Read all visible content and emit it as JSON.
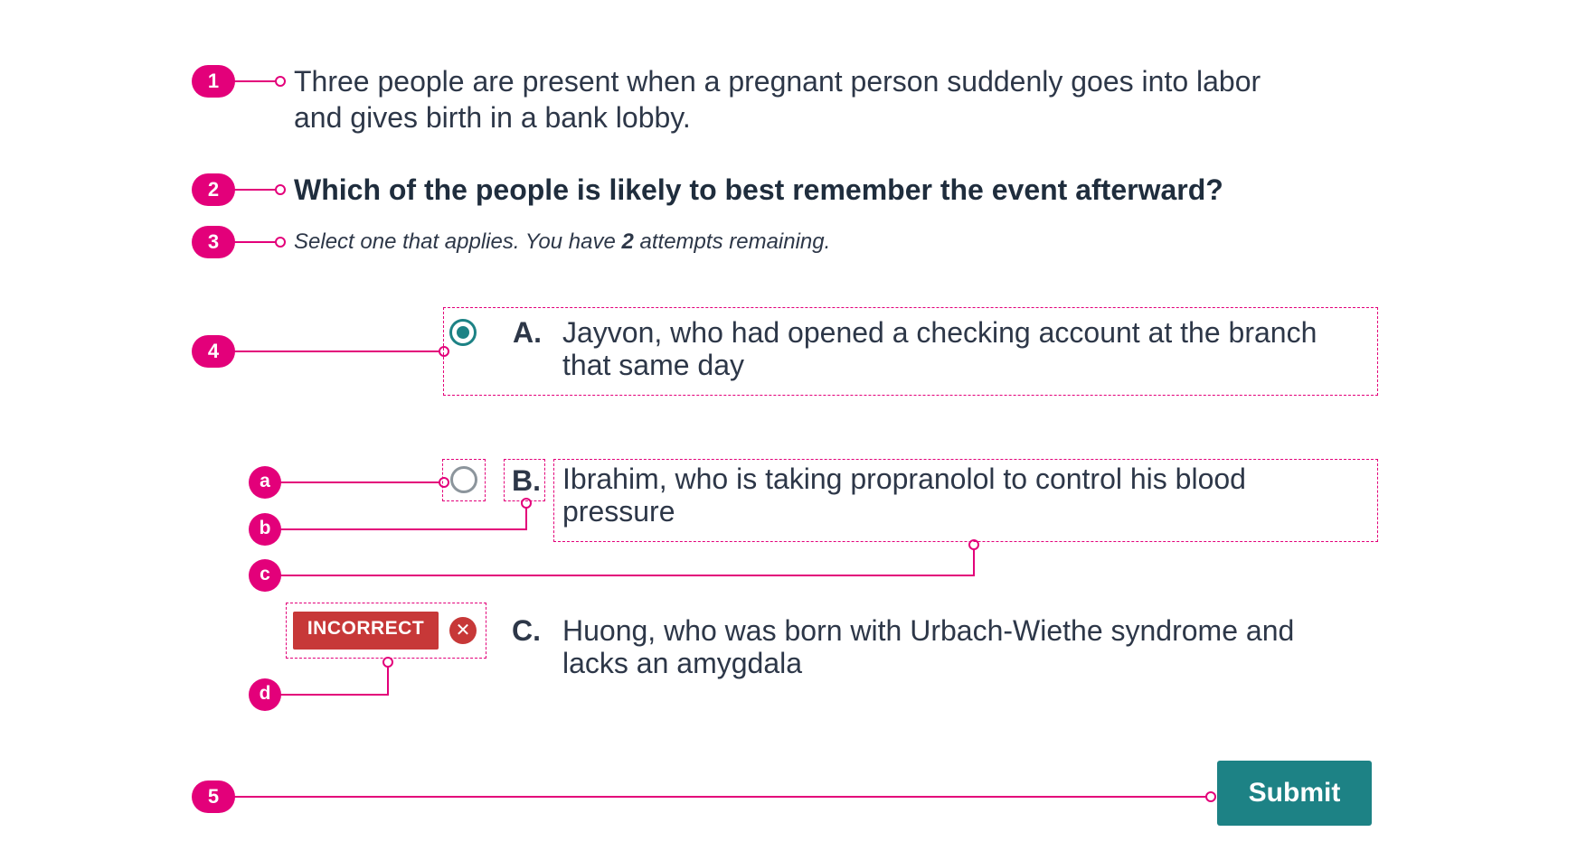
{
  "callouts": {
    "n1": "1",
    "n2": "2",
    "n3": "3",
    "n4": "4",
    "n5": "5",
    "a": "a",
    "b": "b",
    "c": "c",
    "d": "d"
  },
  "stem": {
    "line1": "Three people are present when a pregnant person suddenly goes into labor",
    "line2": "and gives birth in a bank lobby."
  },
  "question": "Which of the people is likely to best remember the event afterward?",
  "instructions": {
    "prefix": "Select one that applies. You have ",
    "attempts": "2",
    "suffix": " attempts remaining."
  },
  "options": [
    {
      "letter": "A.",
      "line1": "Jayvon, who had opened a checking account at the branch",
      "line2": "that same day",
      "state": "selected"
    },
    {
      "letter": "B.",
      "line1": "Ibrahim, who is taking propranolol to control his blood",
      "line2": "pressure",
      "state": "unselected"
    },
    {
      "letter": "C.",
      "line1": "Huong, who was born with Urbach-Wiethe syndrome and",
      "line2": "lacks an amygdala",
      "state": "incorrect"
    }
  ],
  "feedback": {
    "label": "INCORRECT",
    "icon": "close-circle-icon"
  },
  "submit_label": "Submit",
  "colors": {
    "annotation": "#e3007a",
    "accent": "#1d8285",
    "error": "#c73838",
    "text": "#2d3748"
  }
}
